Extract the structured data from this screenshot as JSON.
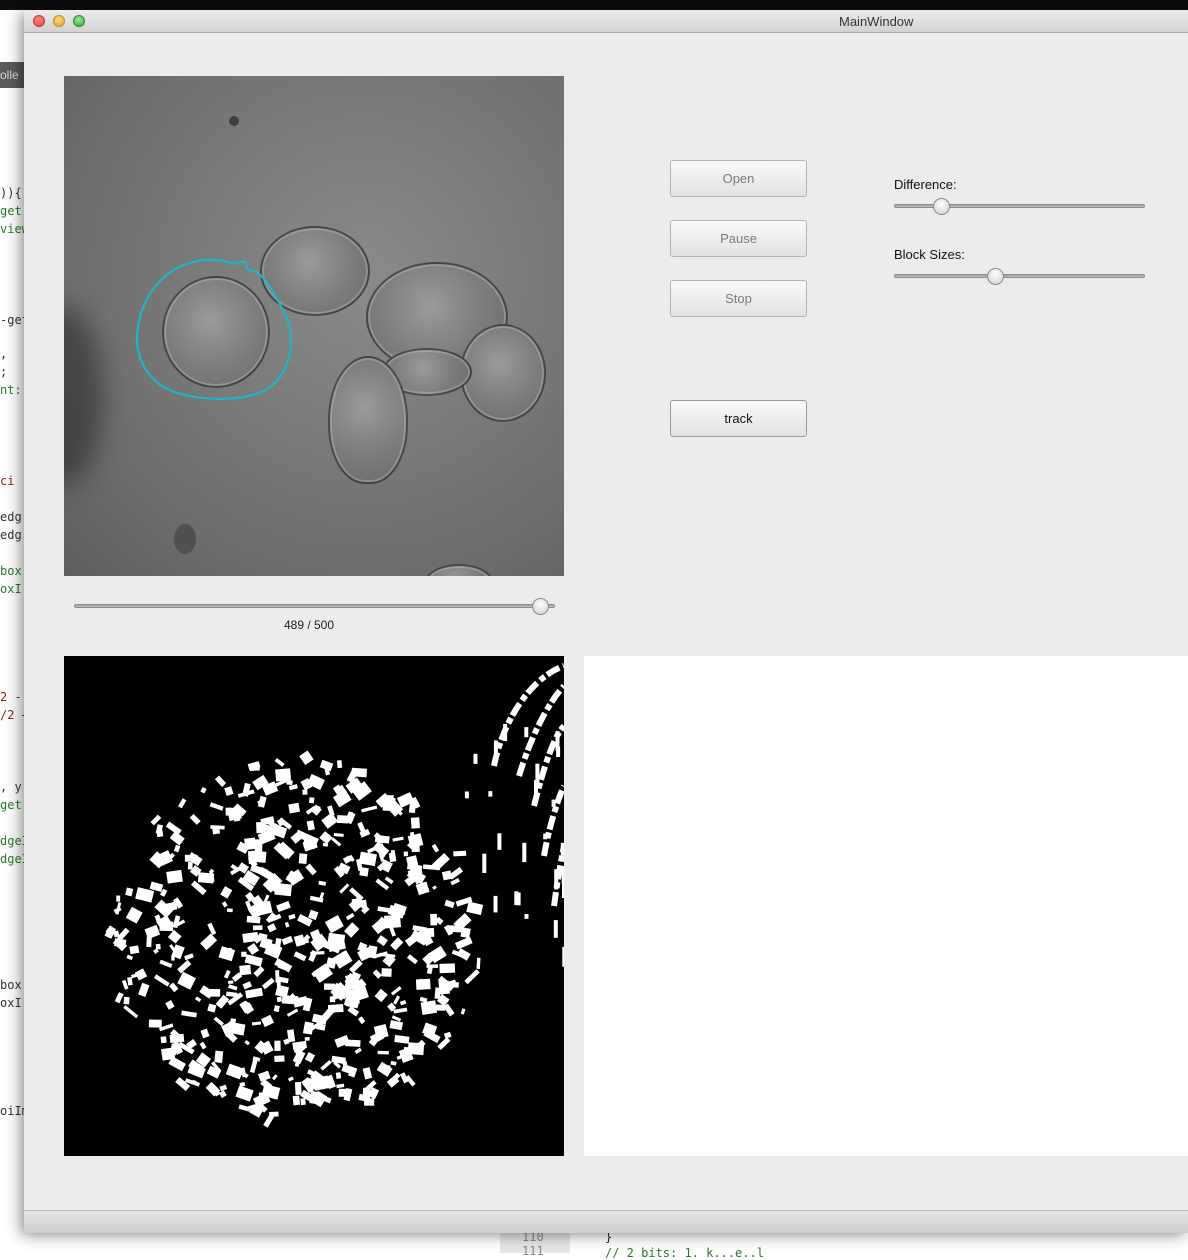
{
  "background_editor": {
    "tab_label": "olle",
    "code_fragments": [
      {
        "text": ")){",
        "color": "#333333"
      },
      {
        "text": "get(",
        "color": "#2a7a2a"
      },
      {
        "text": "view",
        "color": "#2a7a2a"
      },
      {
        "text": "-get",
        "color": "#333333"
      },
      {
        "text": ",",
        "color": "#333333"
      },
      {
        "text": ";",
        "color": "#333333"
      },
      {
        "text": "nt::",
        "color": "#2a7a2a"
      },
      {
        "text": "ci",
        "color": "#8b1a1a"
      },
      {
        "text": "edg",
        "color": "#333333"
      },
      {
        "text": "edg",
        "color": "#333333"
      },
      {
        "text": "box",
        "color": "#2a7a2a"
      },
      {
        "text": "oxI",
        "color": "#2a7a2a"
      },
      {
        "text": "2 -",
        "color": "#8b1a1a"
      },
      {
        "text": "/2 +",
        "color": "#8b1a1a"
      },
      {
        "text": ", y",
        "color": "#333333"
      },
      {
        "text": "get",
        "color": "#2a7a2a"
      },
      {
        "text": "dgeI",
        "color": "#2a7a2a"
      },
      {
        "text": "dgeI",
        "color": "#2a7a2a"
      },
      {
        "text": "box",
        "color": "#333333"
      },
      {
        "text": "oxI",
        "color": "#333333"
      },
      {
        "text": "oiIm",
        "color": "#333333"
      }
    ],
    "line_numbers": [
      "110",
      "111"
    ],
    "closing_brace": "}",
    "comment_fragment": "// 2 bits: 1. k...e..l"
  },
  "window": {
    "title": "MainWindow"
  },
  "controls": {
    "open_label": "Open",
    "pause_label": "Pause",
    "stop_label": "Stop",
    "track_label": "track",
    "difference_label": "Difference:",
    "block_sizes_label": "Block Sizes:",
    "difference_value": 0.15,
    "block_sizes_value": 0.38
  },
  "frame_slider": {
    "label": "489 / 500",
    "current": 489,
    "total": 500
  },
  "colors": {
    "tracking_contour": "#1fb5c9",
    "window_bg": "#ececec"
  }
}
